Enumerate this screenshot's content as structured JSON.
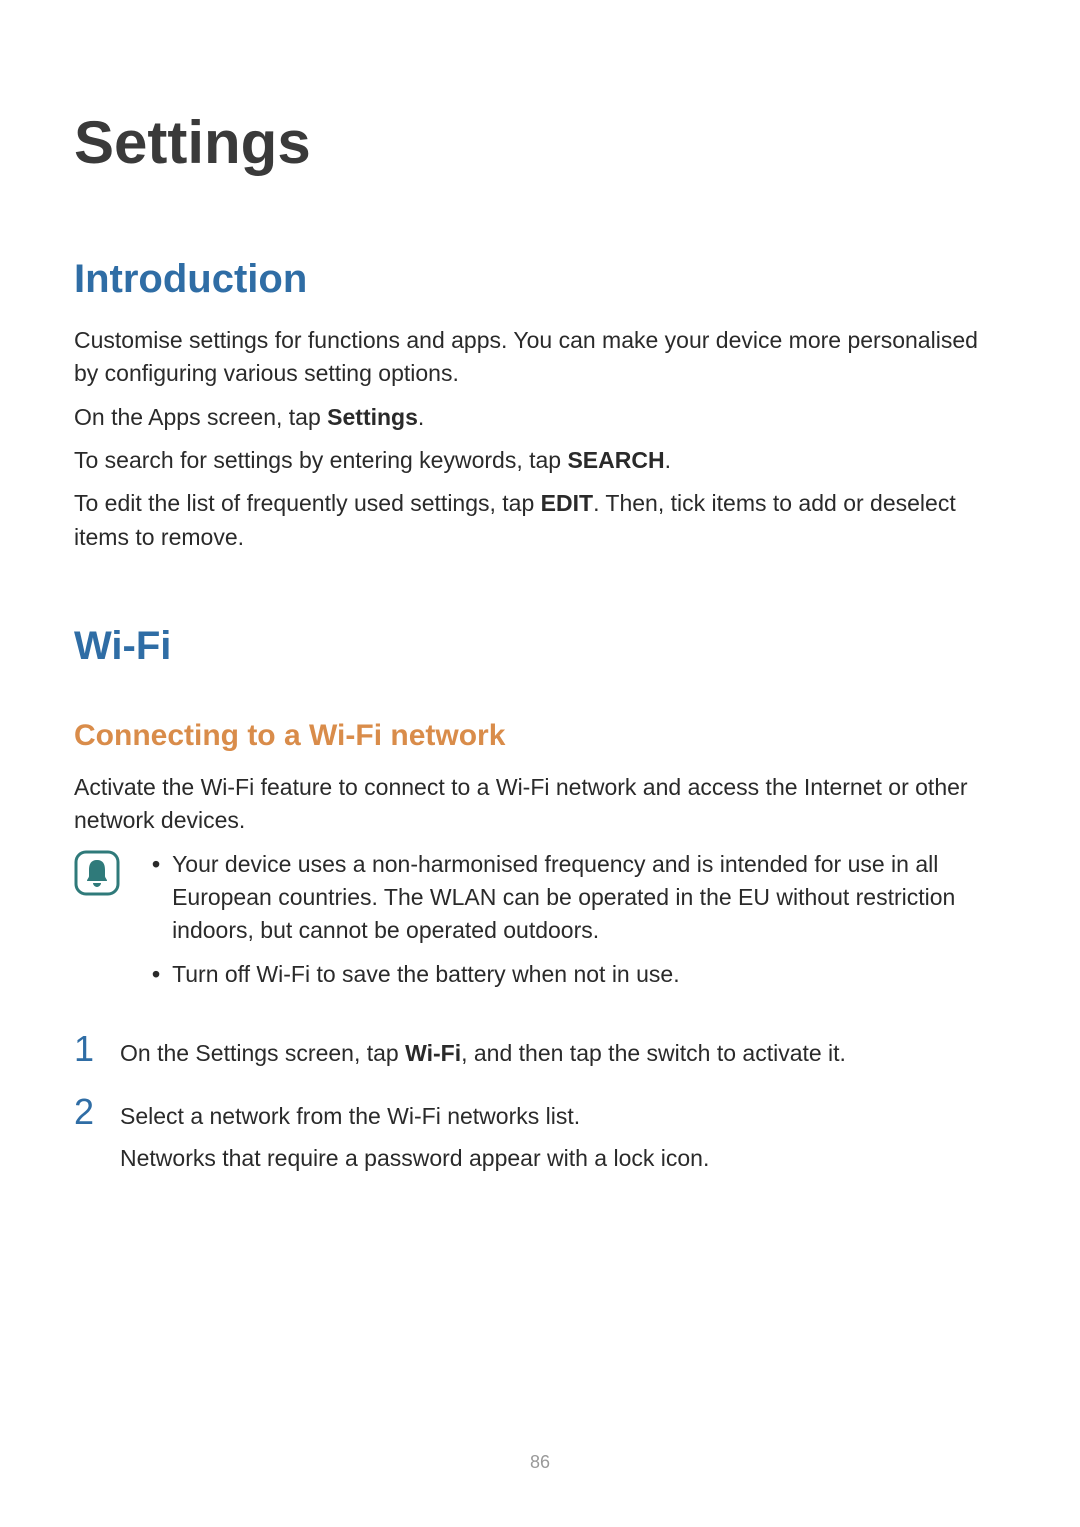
{
  "page_title": "Settings",
  "intro": {
    "heading": "Introduction",
    "para1": "Customise settings for functions and apps. You can make your device more personalised by configuring various setting options.",
    "para2_pre": "On the Apps screen, tap ",
    "para2_bold": "Settings",
    "para2_post": ".",
    "para3_pre": "To search for settings by entering keywords, tap ",
    "para3_bold": "SEARCH",
    "para3_post": ".",
    "para4_pre": "To edit the list of frequently used settings, tap ",
    "para4_bold": "EDIT",
    "para4_post": ". Then, tick items to add or deselect items to remove."
  },
  "wifi": {
    "heading": "Wi-Fi",
    "sub_heading": "Connecting to a Wi-Fi network",
    "para1": "Activate the Wi-Fi feature to connect to a Wi-Fi network and access the Internet or other network devices.",
    "notice_bullets": [
      "Your device uses a non-harmonised frequency and is intended for use in all European countries. The WLAN can be operated in the EU without restriction indoors, but cannot be operated outdoors.",
      "Turn off Wi-Fi to save the battery when not in use."
    ],
    "steps": {
      "s1": {
        "num": "1",
        "pre": "On the Settings screen, tap ",
        "bold": "Wi-Fi",
        "post": ", and then tap the switch to activate it."
      },
      "s2": {
        "num": "2",
        "line1": "Select a network from the Wi-Fi networks list.",
        "line2": "Networks that require a password appear with a lock icon."
      }
    }
  },
  "page_number": "86",
  "bullet_dot": "•"
}
